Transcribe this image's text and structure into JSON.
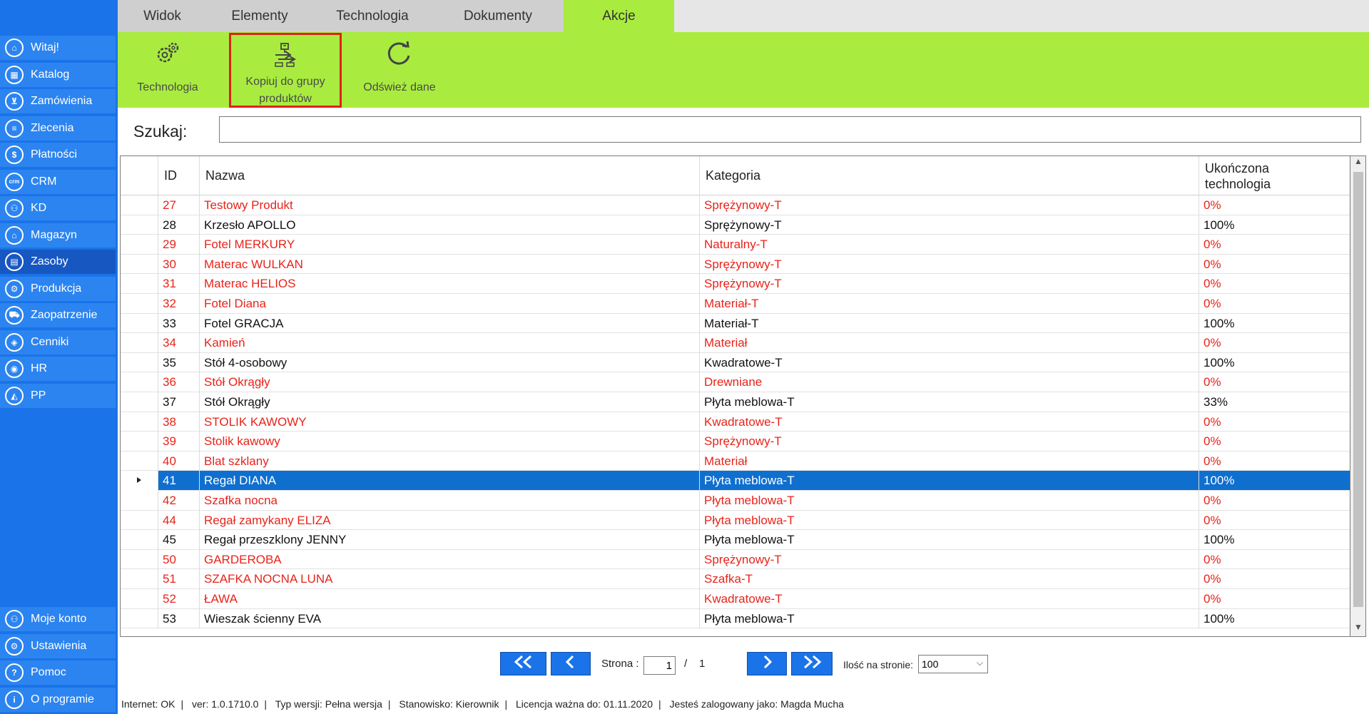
{
  "tabs": [
    "Widok",
    "Elementy",
    "Technologia",
    "Dokumenty",
    "Akcje"
  ],
  "active_tab": "Akcje",
  "ribbon": {
    "technologia": "Technologia",
    "kopiuj_line1": "Kopiuj do grupy",
    "kopiuj_line2": "produktów",
    "odswiez": "Odśwież dane"
  },
  "sidebar": {
    "items": [
      {
        "label": "Witaj!",
        "icon": "home-icon",
        "glyph": "⌂"
      },
      {
        "label": "Katalog",
        "icon": "book-icon",
        "glyph": "▦"
      },
      {
        "label": "Zamówienia",
        "icon": "cart-icon",
        "glyph": "⊻"
      },
      {
        "label": "Zlecenia",
        "icon": "list-icon",
        "glyph": "≡"
      },
      {
        "label": "Płatności",
        "icon": "dollar-icon",
        "glyph": "$"
      },
      {
        "label": "CRM",
        "icon": "crm-icon",
        "glyph": "crm"
      },
      {
        "label": "KD",
        "icon": "user-icon",
        "glyph": "⚇"
      },
      {
        "label": "Magazyn",
        "icon": "warehouse-icon",
        "glyph": "⌂"
      },
      {
        "label": "Zasoby",
        "icon": "resources-icon",
        "glyph": "▤"
      },
      {
        "label": "Produkcja",
        "icon": "production-icon",
        "glyph": "⚙"
      },
      {
        "label": "Zaopatrzenie",
        "icon": "truck-icon",
        "glyph": "⛟"
      },
      {
        "label": "Cenniki",
        "icon": "tag-icon",
        "glyph": "◈"
      },
      {
        "label": "HR",
        "icon": "hr-icon",
        "glyph": "◉"
      },
      {
        "label": "PP",
        "icon": "pp-icon",
        "glyph": "◭"
      }
    ],
    "bottom": [
      {
        "label": "Moje konto",
        "icon": "account-icon",
        "glyph": "⚇"
      },
      {
        "label": "Ustawienia",
        "icon": "settings-icon",
        "glyph": "⚙"
      },
      {
        "label": "Pomoc",
        "icon": "help-icon",
        "glyph": "?"
      },
      {
        "label": "O programie",
        "icon": "info-icon",
        "glyph": "i"
      }
    ]
  },
  "search": {
    "label": "Szukaj:",
    "value": ""
  },
  "grid": {
    "headers": {
      "id": "ID",
      "nazwa": "Nazwa",
      "kategoria": "Kategoria",
      "tech_line1": "Ukończona",
      "tech_line2": "technologia"
    },
    "rows": [
      {
        "id": "27",
        "nazwa": "Testowy Produkt",
        "kategoria": "Sprężynowy-T",
        "tech": "0%",
        "red": true
      },
      {
        "id": "28",
        "nazwa": "Krzesło APOLLO",
        "kategoria": "Sprężynowy-T",
        "tech": "100%",
        "red": false
      },
      {
        "id": "29",
        "nazwa": "Fotel MERKURY",
        "kategoria": "Naturalny-T",
        "tech": "0%",
        "red": true
      },
      {
        "id": "30",
        "nazwa": "Materac WULKAN",
        "kategoria": "Sprężynowy-T",
        "tech": "0%",
        "red": true
      },
      {
        "id": "31",
        "nazwa": "Materac HELIOS",
        "kategoria": "Sprężynowy-T",
        "tech": "0%",
        "red": true
      },
      {
        "id": "32",
        "nazwa": "Fotel Diana",
        "kategoria": "Materiał-T",
        "tech": "0%",
        "red": true
      },
      {
        "id": "33",
        "nazwa": "Fotel GRACJA",
        "kategoria": "Materiał-T",
        "tech": "100%",
        "red": false
      },
      {
        "id": "34",
        "nazwa": "Kamień",
        "kategoria": "Materiał",
        "tech": "0%",
        "red": true
      },
      {
        "id": "35",
        "nazwa": "Stół 4-osobowy",
        "kategoria": "Kwadratowe-T",
        "tech": "100%",
        "red": false
      },
      {
        "id": "36",
        "nazwa": "Stół Okrągły",
        "kategoria": "Drewniane",
        "tech": "0%",
        "red": true
      },
      {
        "id": "37",
        "nazwa": "Stół Okrągły",
        "kategoria": "Płyta meblowa-T",
        "tech": "33%",
        "red": false
      },
      {
        "id": "38",
        "nazwa": "STOLIK KAWOWY",
        "kategoria": "Kwadratowe-T",
        "tech": "0%",
        "red": true
      },
      {
        "id": "39",
        "nazwa": "Stolik kawowy",
        "kategoria": "Sprężynowy-T",
        "tech": "0%",
        "red": true
      },
      {
        "id": "40",
        "nazwa": "Blat szklany",
        "kategoria": "Materiał",
        "tech": "0%",
        "red": true
      },
      {
        "id": "41",
        "nazwa": "Regał DIANA",
        "kategoria": "Płyta meblowa-T",
        "tech": "100%",
        "red": false,
        "selected": true
      },
      {
        "id": "42",
        "nazwa": "Szafka nocna",
        "kategoria": "Płyta meblowa-T",
        "tech": "0%",
        "red": true
      },
      {
        "id": "44",
        "nazwa": "Regał zamykany ELIZA",
        "kategoria": "Płyta meblowa-T",
        "tech": "0%",
        "red": true
      },
      {
        "id": "45",
        "nazwa": "Regał przeszklony JENNY",
        "kategoria": "Płyta meblowa-T",
        "tech": "100%",
        "red": false
      },
      {
        "id": "50",
        "nazwa": "GARDEROBA",
        "kategoria": "Sprężynowy-T",
        "tech": "0%",
        "red": true
      },
      {
        "id": "51",
        "nazwa": "SZAFKA NOCNA LUNA",
        "kategoria": "Szafka-T",
        "tech": "0%",
        "red": true
      },
      {
        "id": "52",
        "nazwa": "ŁAWA",
        "kategoria": "Kwadratowe-T",
        "tech": "0%",
        "red": true
      },
      {
        "id": "53",
        "nazwa": "Wieszak ścienny EVA",
        "kategoria": "Płyta meblowa-T",
        "tech": "100%",
        "red": false
      }
    ]
  },
  "pager": {
    "page_label": "Strona :",
    "current_page": "1",
    "slash": "/",
    "total_pages": "1",
    "per_page_label": "Ilość na stronie:",
    "per_page_value": "100"
  },
  "status": {
    "internet": "Internet: OK",
    "version": "ver: 1.0.1710.0",
    "type": "Typ wersji: Pełna wersja",
    "station": "Stanowisko: Kierownik",
    "license": "Licencja ważna do: 01.11.2020",
    "user": "Jesteś zalogowany jako: Magda Mucha"
  },
  "colors": {
    "sidebar": "#1a73e8",
    "ribbon": "#a9ec3f",
    "selected_row": "#0f6fcf",
    "red_text": "#e8231a",
    "highlight_border": "#e0201c"
  }
}
